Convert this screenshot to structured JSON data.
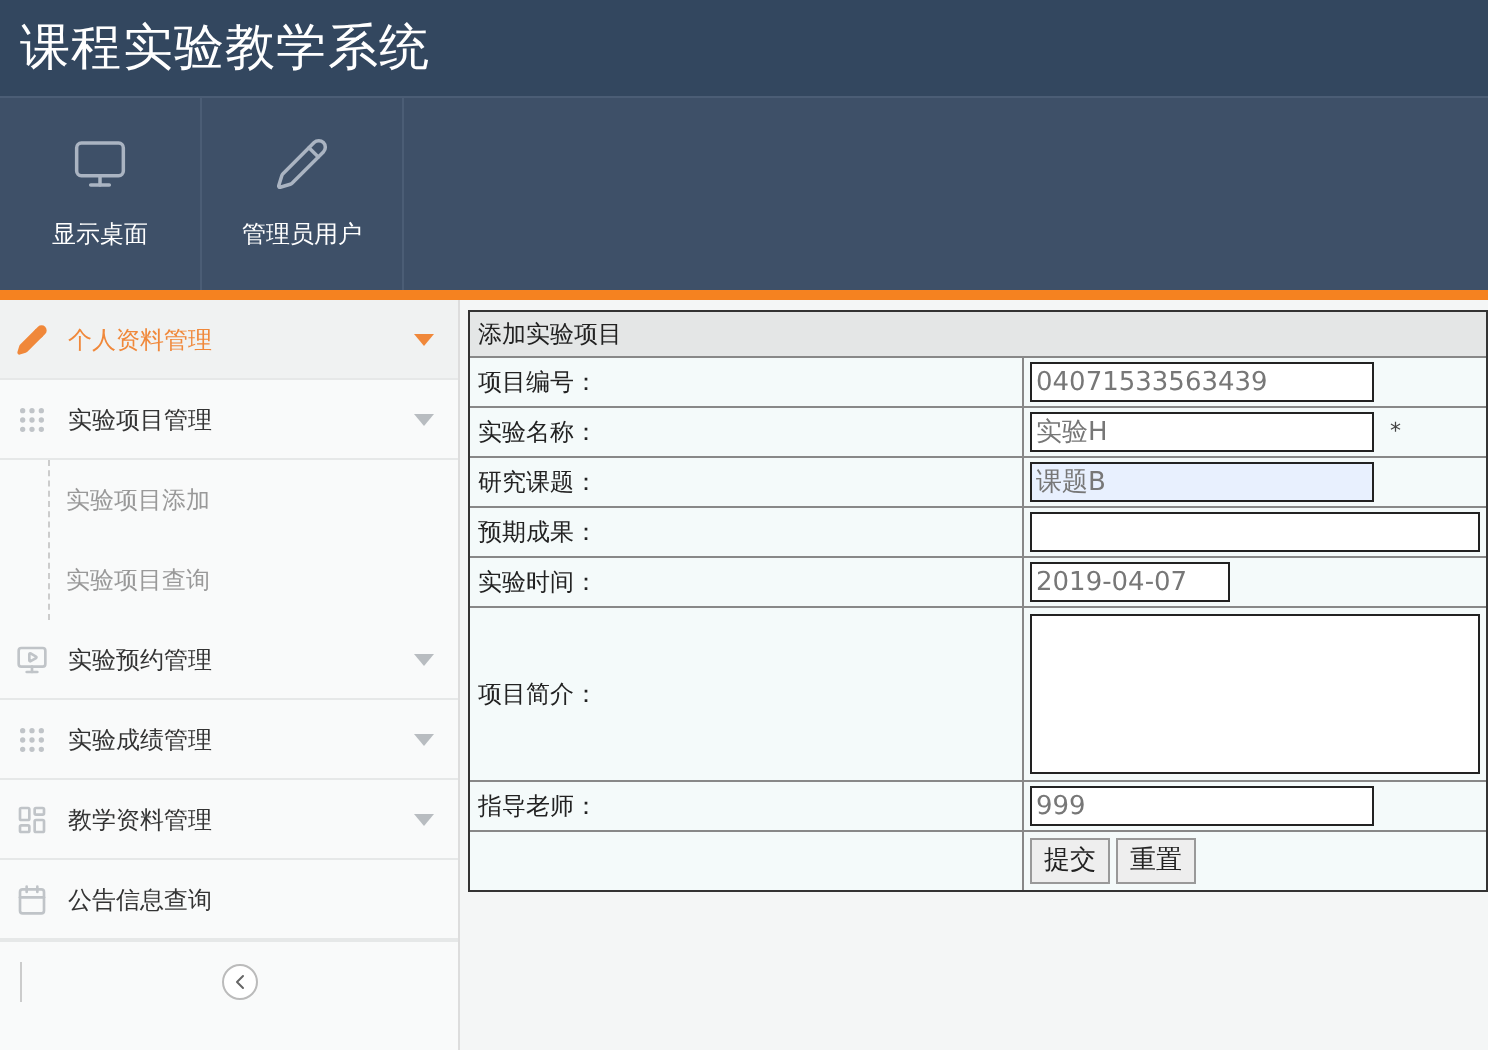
{
  "app_title": "课程实验教学系统",
  "toolbar": [
    {
      "label": "显示桌面"
    },
    {
      "label": "管理员用户"
    }
  ],
  "sidebar": {
    "items": [
      {
        "label": "个人资料管理",
        "selected": true
      },
      {
        "label": "实验项目管理",
        "selected": false,
        "children": [
          {
            "label": "实验项目添加"
          },
          {
            "label": "实验项目查询"
          }
        ]
      },
      {
        "label": "实验预约管理",
        "selected": false
      },
      {
        "label": "实验成绩管理",
        "selected": false
      },
      {
        "label": "教学资料管理",
        "selected": false
      },
      {
        "label": "公告信息查询",
        "selected": false,
        "has_caret": false
      }
    ]
  },
  "form": {
    "title": "添加实验项目",
    "fields": [
      {
        "label": "项目编号：",
        "kind": "text",
        "value": "04071533563439",
        "focused": false
      },
      {
        "label": "实验名称：",
        "kind": "text",
        "value": "实验H",
        "required": "*",
        "focused": false
      },
      {
        "label": "研究课题：",
        "kind": "text",
        "value": "课题B",
        "focused": true
      },
      {
        "label": "预期成果：",
        "kind": "wide",
        "focused": false
      },
      {
        "label": "实验时间：",
        "kind": "date",
        "value": "2019-04-07",
        "focused": false
      },
      {
        "label": "项目简介：",
        "kind": "textarea",
        "focused": false
      },
      {
        "label": "指导老师：",
        "kind": "text",
        "value": "999",
        "focused": false
      }
    ],
    "buttons": [
      "提交",
      "重置"
    ]
  }
}
